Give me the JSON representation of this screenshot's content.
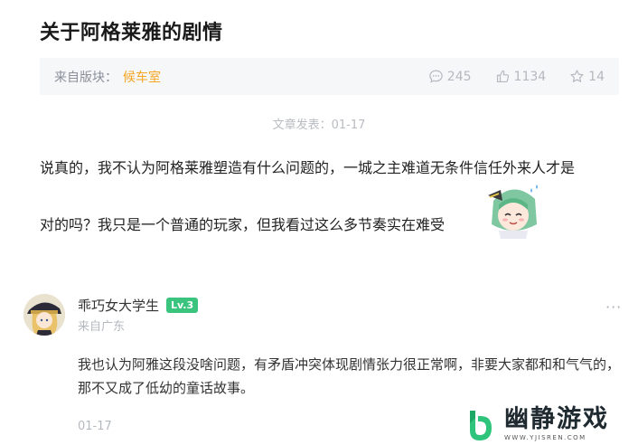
{
  "post": {
    "title": "关于阿格莱雅的剧情",
    "section_label": "来自版块：",
    "section_name": "候车室",
    "stats": {
      "comments": "245",
      "likes": "1134",
      "favorites": "14"
    },
    "publish_date": "文章发表：01-17",
    "body_line1": "说真的，我不认为阿格莱雅塑造有什么问题的，一城之主难道无条件信任外来人才是",
    "body_line2": "对的吗？我只是一个普通的玩家，但我看过这么多节奏实在难受"
  },
  "comment": {
    "username": "乖巧女大学生",
    "level": "Lv.3",
    "location": "来自广东",
    "more": "···",
    "text": "我也认为阿雅这段没啥问题，有矛盾冲突体现剧情张力很正常啊，非要大家都和和气气的，那不又成了低幼的童话故事。",
    "date": "01-17"
  },
  "watermark": {
    "brand": "幽静游戏",
    "url": "WWW.YJISREN.COM"
  },
  "colors": {
    "accent_orange": "#f5a623",
    "level_green": "#3ac47d",
    "meta_bg": "#f6f7f9",
    "muted_text": "#b4b8bf"
  },
  "icons": {
    "comments": "comment-bubble-icon",
    "likes": "thumbs-up-icon",
    "favorites": "star-icon"
  }
}
